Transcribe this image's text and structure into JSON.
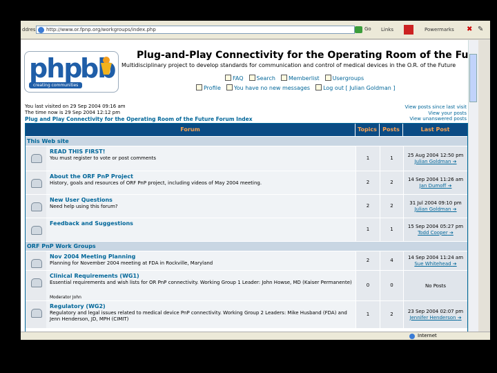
{
  "browser": {
    "address_label": "ddress",
    "url": "http://www.or.fpnp.org/workgroups/index.php",
    "go_label": "Go",
    "links_label": "Links",
    "extra_label": "Powermarks",
    "status_zone": "Internet"
  },
  "header": {
    "logo_php": "php",
    "logo_bb": "bb",
    "logo_tagline": "creating communities",
    "site_title": "Plug-and-Play Connectivity for the Operating Room of the Future",
    "site_description": "Multidisciplinary project to develop standards for communication and control of medical devices in the O.R. of the Future",
    "nav_row1": [
      {
        "icon": "faq-icon",
        "label": "FAQ"
      },
      {
        "icon": "search-icon",
        "label": "Search"
      },
      {
        "icon": "memberlist-icon",
        "label": "Memberlist"
      },
      {
        "icon": "usergroups-icon",
        "label": "Usergroups"
      }
    ],
    "nav_row2": [
      {
        "icon": "profile-icon",
        "label": "Profile"
      },
      {
        "icon": "messages-icon",
        "label": "You have no new messages"
      },
      {
        "icon": "logout-icon",
        "label": "Log out [ Julian Goldman ]"
      }
    ]
  },
  "info": {
    "last_visit": "You last visited on 29 Sep 2004 09:16 am",
    "time_now": "The time now is 29 Sep 2004 12:12 pm",
    "forum_index": "Plug and Play Connectivity for the Operating Room of the Future Forum Index",
    "link_since_last": "View posts since last visit",
    "link_your_posts": "View your posts",
    "link_unanswered": "View unanswered posts"
  },
  "table": {
    "headers": {
      "forum": "Forum",
      "topics": "Topics",
      "posts": "Posts",
      "last_post": "Last Post"
    },
    "categories": [
      {
        "name": "This Web site",
        "forums": [
          {
            "title": "READ THIS FIRST!",
            "desc": "You must register to vote or post comments",
            "moderator": "",
            "topics": "1",
            "posts": "1",
            "last_date": "25 Aug 2004 12:50 pm",
            "last_user": "Julian Goldman"
          },
          {
            "title": "About the ORF PnP Project",
            "desc": "History, goals and resources of ORF PnP project, including videos of May 2004 meeting.",
            "moderator": "",
            "topics": "2",
            "posts": "2",
            "last_date": "14 Sep 2004 11:26 am",
            "last_user": "Jan Dumoff"
          },
          {
            "title": "New User Questions",
            "desc": "Need help using this forum?",
            "moderator": "",
            "topics": "2",
            "posts": "2",
            "last_date": "31 Jul 2004 09:10 pm",
            "last_user": "Julian Goldman"
          },
          {
            "title": "Feedback and Suggestions",
            "desc": "",
            "moderator": "",
            "topics": "1",
            "posts": "1",
            "last_date": "15 Sep 2004 05:27 pm",
            "last_user": "Todd Cooper"
          }
        ]
      },
      {
        "name": "ORF PnP Work Groups",
        "forums": [
          {
            "title": "Nov 2004 Meeting Planning",
            "desc": "Planning for November 2004 meeting at FDA in Rockville, Maryland",
            "moderator": "",
            "topics": "2",
            "posts": "4",
            "last_date": "14 Sep 2004 11:24 am",
            "last_user": "Sue Whitehead"
          },
          {
            "title": "Clinical Requirements (WG1)",
            "desc": "Essential requirements and wish lists for OR PnP connectivity. Working Group 1 Leader: John Howse, MD (Kaiser Permanente)",
            "moderator": "Moderator John",
            "topics": "0",
            "posts": "0",
            "last_date": "",
            "last_user": "",
            "no_posts": "No Posts"
          },
          {
            "title": "Regulatory (WG2)",
            "desc": "Regulatory and legal issues related to medical device PnP connectivity. Working Group 2 Leaders: Mike Husband (FDA) and Jenn Henderson, JD, MPH (CIMIT)",
            "moderator": "",
            "topics": "1",
            "posts": "2",
            "last_date": "23 Sep 2004 02:07 pm",
            "last_user": "Jennifer Henderson"
          }
        ]
      }
    ]
  }
}
